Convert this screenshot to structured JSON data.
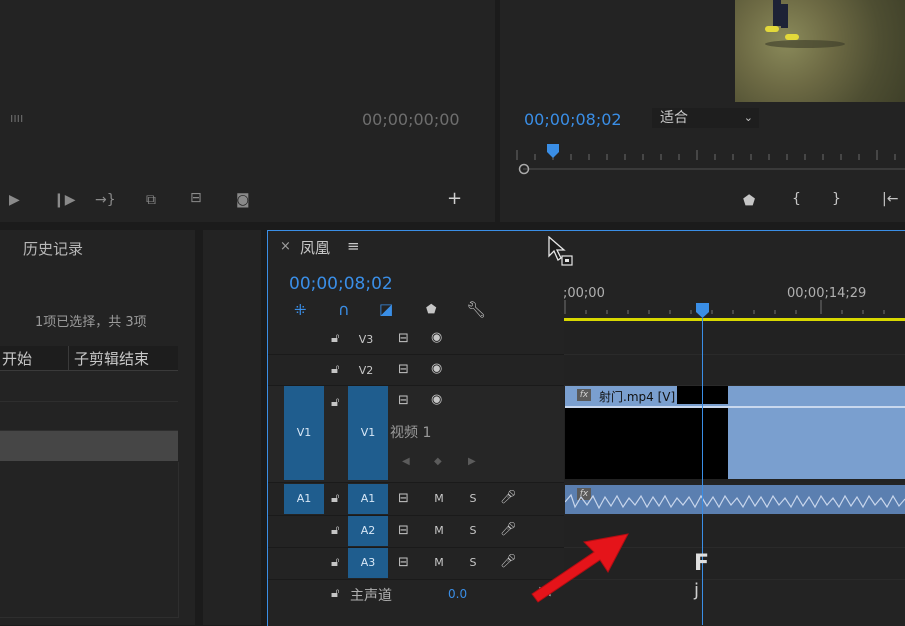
{
  "source_monitor": {
    "timecode": "00;00;00;00"
  },
  "program_monitor": {
    "timecode": "00;00;08;02",
    "fit_select": "适合"
  },
  "project_panel": {
    "tab": "历史记录",
    "selection_info": "1项已选择，共 3项",
    "col_start": "开始",
    "col_end": "子剪辑结束"
  },
  "timeline": {
    "sequence_name": "凤凰",
    "timecode": "00;00;08;02",
    "ruler_start": ";00;00",
    "ruler_mid": "00;00;14;29",
    "tracks": {
      "v3": "V3",
      "v2": "V2",
      "v1": "V1",
      "v1_src": "V1",
      "v1_name": "视频 1",
      "a1": "A1",
      "a1_src": "A1",
      "a2": "A2",
      "a3": "A3",
      "m": "M",
      "s": "S",
      "master_label": "主声道",
      "master_value": "0.0"
    },
    "clip_video_name": "射门.mp4 [V]",
    "fx": "fx",
    "accent_blue": "#3a8ee6",
    "track_blue": "#1f5d8e",
    "clip_blue": "#7a9fcf"
  }
}
